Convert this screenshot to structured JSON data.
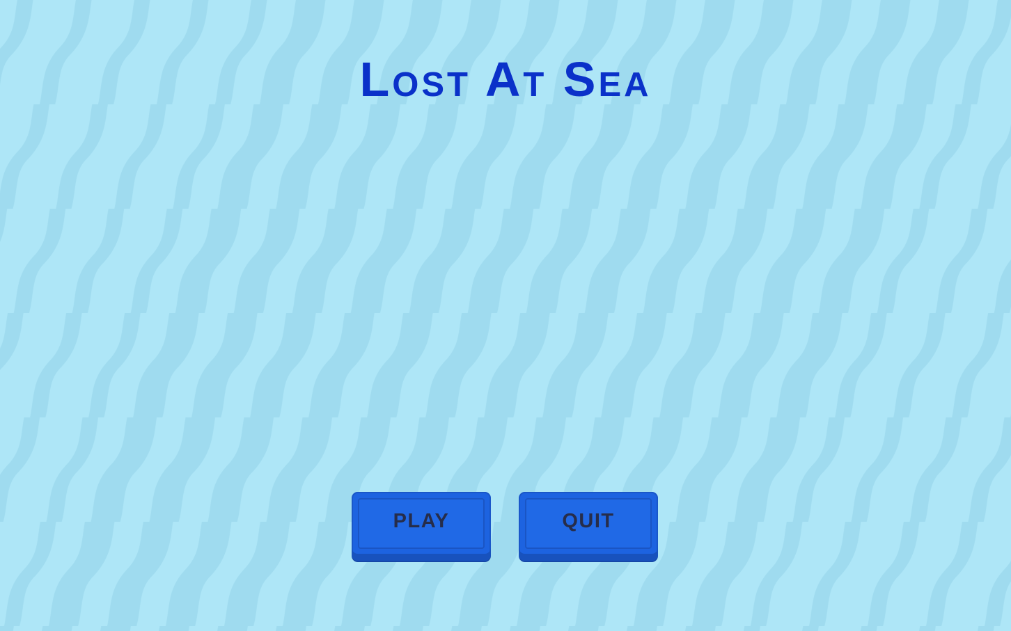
{
  "screen": "main-menu",
  "title": "Lost At Sea",
  "buttons": {
    "play_label": "PLAY",
    "quit_label": "QUIT"
  },
  "colors": {
    "background": "#aee6f7",
    "wave_stripe": "#9fdbef",
    "title": "#0a31c9",
    "button_fill": "#1d63e0",
    "button_text": "#262d4a"
  }
}
